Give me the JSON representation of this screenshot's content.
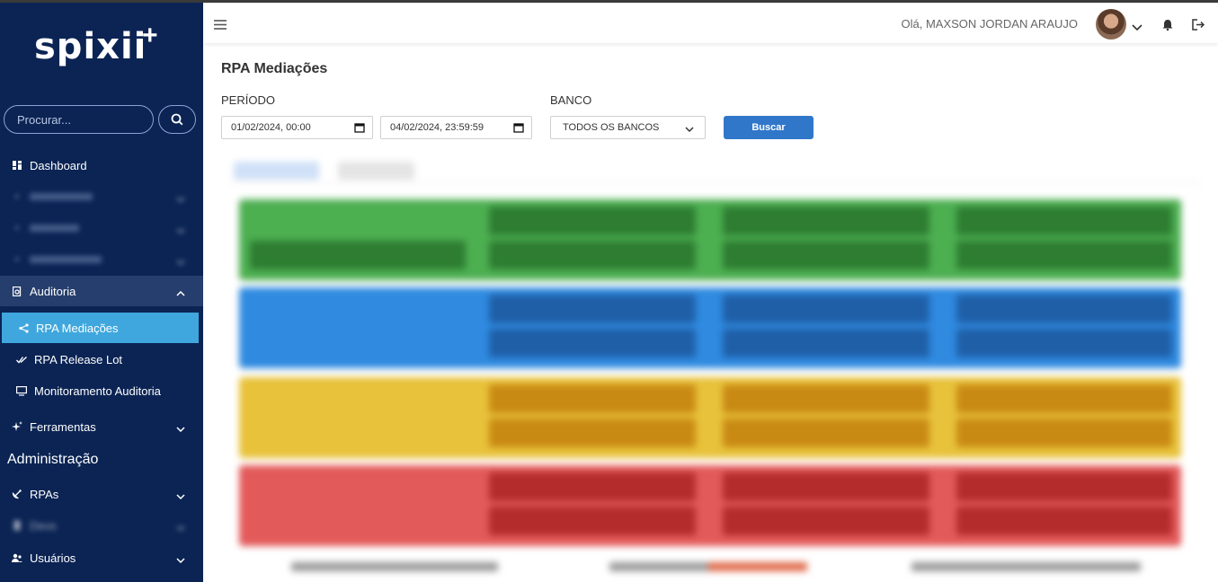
{
  "app": {
    "logo_text": "spixii",
    "logo_plus": "+"
  },
  "sidebar": {
    "search_placeholder": "Procurar...",
    "items": [
      {
        "label": "Dashboard"
      },
      {
        "label": "Auditoria"
      },
      {
        "label": "RPA Mediações"
      },
      {
        "label": "RPA Release Lot"
      },
      {
        "label": "Monitoramento Auditoria"
      },
      {
        "label": "Ferramentas"
      },
      {
        "label": "RPAs"
      },
      {
        "label": "Devs"
      },
      {
        "label": "Usuários"
      }
    ],
    "section_admin": "Administração"
  },
  "topbar": {
    "greeting": "Olá, MAXSON JORDAN ARAUJO"
  },
  "main": {
    "title": "RPA Mediações",
    "periodo_label": "PERÍODO",
    "date_start": "01/02/2024, 00:00",
    "date_end": "04/02/2024, 23:59:59",
    "banco_label": "BANCO",
    "banco_value": "TODOS OS BANCOS",
    "search_button": "Buscar"
  },
  "colors": {
    "sidebar_bg": "#0b2454",
    "active_item": "#3fa7dd",
    "button": "#3077c9",
    "row_green": "#4caf50",
    "row_blue": "#2f8ae0",
    "row_yellow": "#e8c23a",
    "row_red": "#e35a5a"
  }
}
